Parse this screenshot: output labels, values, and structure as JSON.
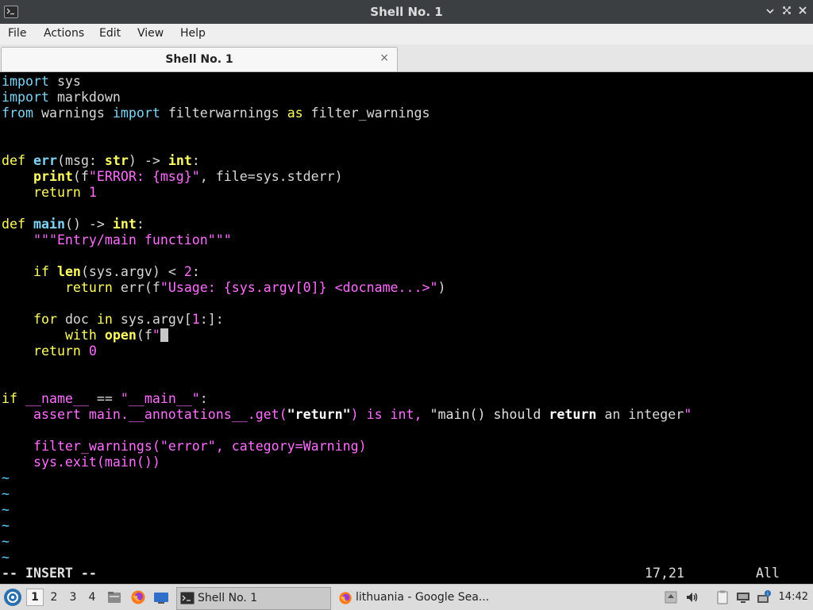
{
  "window": {
    "title": "Shell No. 1"
  },
  "menubar": {
    "items": [
      "File",
      "Actions",
      "Edit",
      "View",
      "Help"
    ]
  },
  "tab": {
    "label": "Shell No. 1",
    "close_glyph": "×"
  },
  "editor": {
    "lines": [
      "import sys",
      "import markdown",
      "from warnings import filterwarnings as filter_warnings",
      "",
      "",
      "def err(msg: str) -> int:",
      "    print(f\"ERROR: {msg}\", file=sys.stderr)",
      "    return 1",
      "",
      "def main() -> int:",
      "    \"\"\"Entry/main function\"\"\"",
      "",
      "    if len(sys.argv) < 2:",
      "        return err(f\"Usage: {sys.argv[0]} <docname...>\")",
      "",
      "    for doc in sys.argv[1:]:",
      "        with open(f\"",
      "    return 0",
      "",
      "",
      "if __name__ == \"__main__\":",
      "    assert main.__annotations__.get(\"return\") is int, \"main() should return an integer\"",
      "",
      "    filter_warnings(\"error\", category=Warning)",
      "    sys.exit(main())"
    ],
    "tildes": [
      "~",
      "~",
      "~",
      "~",
      "~",
      "~"
    ],
    "status": {
      "mode": "-- INSERT --",
      "position": "17,21",
      "scroll": "All"
    }
  },
  "taskbar": {
    "workspaces": [
      "1",
      "2",
      "3",
      "4"
    ],
    "active_workspace": "1",
    "tasks": [
      {
        "label": "Shell No. 1",
        "icon": "terminal-icon",
        "active": true
      },
      {
        "label": "lithuania - Google Sea...",
        "icon": "firefox-icon",
        "active": false
      }
    ],
    "clock": "14:42"
  }
}
